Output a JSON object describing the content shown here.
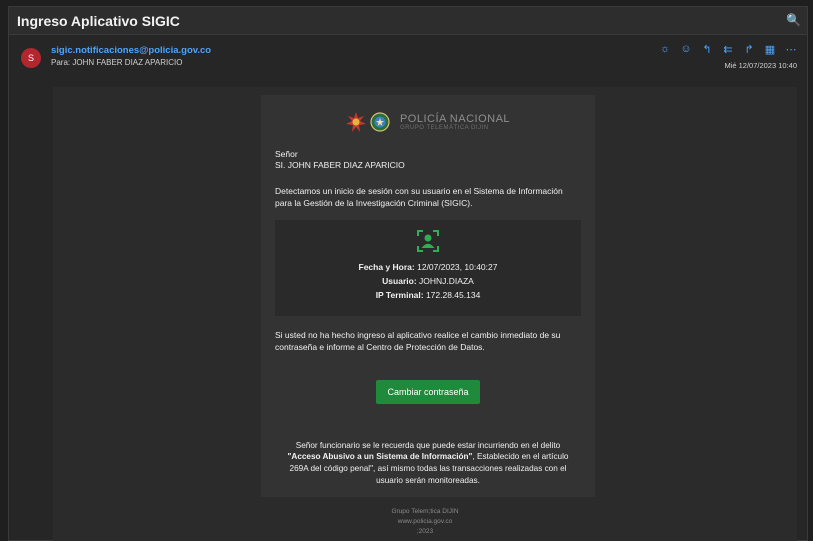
{
  "window": {
    "title": "Ingreso Aplicativo SIGIC",
    "zoom_glyph": "🔍"
  },
  "header": {
    "avatar_letter": "S",
    "sender": "sigic.notificaciones@policia.gov.co",
    "to_line": "Para:  JOHN FABER DIAZ APARICIO",
    "date": "Mié 12/07/2023 10:40"
  },
  "logo": {
    "main": "POLICÍA NACIONAL",
    "sub": "GRUPO TELEMÁTICA DIJIN"
  },
  "body": {
    "greeting_1": "Señor",
    "greeting_2": "SI. JOHN FABER DIAZ APARICIO",
    "intro": "Detectamos un inicio de sesión con su usuario en el Sistema de Información para la Gestión de la Investigación Criminal (SIGIC).",
    "fecha_label": "Fecha y Hora:",
    "fecha_value": "12/07/2023, 10:40:27",
    "usuario_label": "Usuario:",
    "usuario_value": "JOHNJ.DIAZA",
    "ip_label": "IP Terminal:",
    "ip_value": "172.28.45.134",
    "advice": "Si usted no ha hecho ingreso al aplicativo realice el cambio inmediato de su contraseña e informe al Centro de Protección de Datos.",
    "button": "Cambiar contraseña",
    "notice_1": "Señor funcionario se le recuerda que puede estar incurriendo en el delito",
    "notice_bold": "\"Acceso Abusivo a un Sistema de Información\"",
    "notice_2": ", Establecido en el artículo 269A del código penal\", así mismo todas las transacciones realizadas con el usuario serán monitoreadas."
  },
  "footer": {
    "line1": "Grupo Telem;tica DIJIN",
    "line2": "www.policia.gov.co",
    "line3": ";2023"
  },
  "colors": {
    "accent": "#4da3ff",
    "button": "#1f8a3c",
    "icon_green": "#2fb04e",
    "avatar": "#b4262e"
  }
}
